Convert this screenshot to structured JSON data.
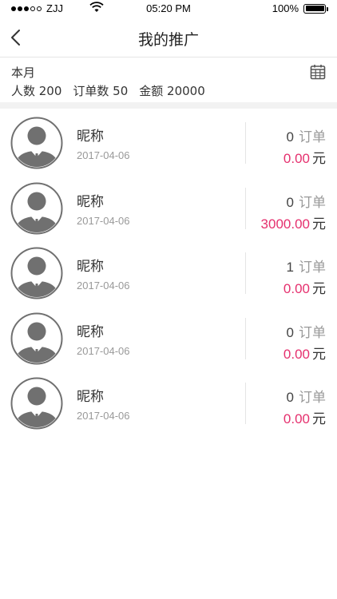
{
  "status_bar": {
    "carrier": "ZJJ",
    "time": "05:20 PM",
    "battery": "100%",
    "battery_level": 1.0
  },
  "nav": {
    "title": "我的推广",
    "back_icon": "chevron-left-icon"
  },
  "summary": {
    "period": "本月",
    "people": "人数 200",
    "orders": "订单数 50",
    "amount": "金额 20000",
    "calendar_icon": "calendar-icon"
  },
  "colors": {
    "accent": "#e5306e",
    "avatar_gray": "#707070"
  },
  "list": [
    {
      "name": "昵称",
      "date": "2017-04-06",
      "order_count": "0",
      "order_label": "订单",
      "amount": "0.00",
      "unit": "元"
    },
    {
      "name": "昵称",
      "date": "2017-04-06",
      "order_count": "0",
      "order_label": "订单",
      "amount": "3000.00",
      "unit": "元"
    },
    {
      "name": "昵称",
      "date": "2017-04-06",
      "order_count": "1",
      "order_label": "订单",
      "amount": "0.00",
      "unit": "元"
    },
    {
      "name": "昵称",
      "date": "2017-04-06",
      "order_count": "0",
      "order_label": "订单",
      "amount": "0.00",
      "unit": "元"
    },
    {
      "name": "昵称",
      "date": "2017-04-06",
      "order_count": "0",
      "order_label": "订单",
      "amount": "0.00",
      "unit": "元"
    }
  ]
}
